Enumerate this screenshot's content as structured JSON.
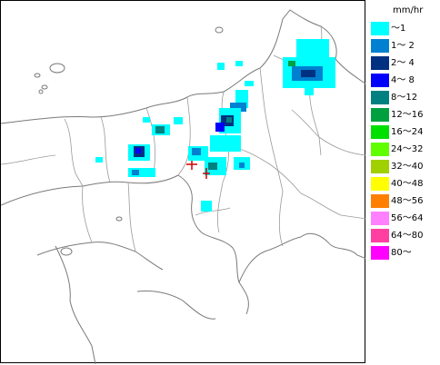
{
  "legend": {
    "unit": "mm/hr",
    "items": [
      {
        "label": "～1",
        "color": "#00ffff"
      },
      {
        "label": "1～ 2",
        "color": "#0080d0"
      },
      {
        "label": "2～ 4",
        "color": "#003080"
      },
      {
        "label": "4～ 8",
        "color": "#0000ff"
      },
      {
        "label": "8～12",
        "color": "#008080"
      },
      {
        "label": "12～16",
        "color": "#00a040"
      },
      {
        "label": "16～24",
        "color": "#00e000"
      },
      {
        "label": "24～32",
        "color": "#60ff00"
      },
      {
        "label": "32～40",
        "color": "#a0d000"
      },
      {
        "label": "40～48",
        "color": "#ffff00"
      },
      {
        "label": "48～56",
        "color": "#ff8000"
      },
      {
        "label": "56～64",
        "color": "#ff80ff"
      },
      {
        "label": "64～80",
        "color": "#ff40a0"
      },
      {
        "label": "80～",
        "color": "#ff00ff"
      }
    ]
  }
}
